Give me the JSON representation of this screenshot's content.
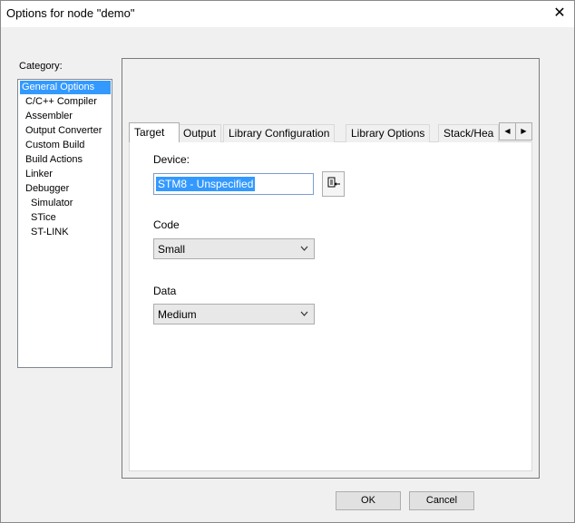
{
  "window": {
    "title": "Options for node \"demo\"",
    "close_symbol": "✕"
  },
  "category": {
    "label": "Category:",
    "items": [
      {
        "label": "General Options",
        "selected": true
      },
      {
        "label": "C/C++ Compiler"
      },
      {
        "label": "Assembler"
      },
      {
        "label": "Output Converter"
      },
      {
        "label": "Custom Build"
      },
      {
        "label": "Build Actions"
      },
      {
        "label": "Linker"
      },
      {
        "label": "Debugger"
      },
      {
        "label": "Simulator"
      },
      {
        "label": "STice"
      },
      {
        "label": "ST-LINK"
      }
    ]
  },
  "tabs": [
    "Target",
    "Output",
    "Library Configuration",
    "Library Options",
    "Stack/Hea"
  ],
  "tab_scroll": {
    "left": "◀",
    "right": "▶"
  },
  "target": {
    "device_label": "Device:",
    "device_value": "STM8 - Unspecified",
    "device_button_icon": "device-select-icon",
    "code_label": "Code",
    "code_value": "Small",
    "data_label": "Data",
    "data_value": "Medium"
  },
  "buttons": {
    "ok": "OK",
    "cancel": "Cancel"
  },
  "colors": {
    "selection": "#3399ff",
    "window_bg": "#f0f0f0"
  }
}
